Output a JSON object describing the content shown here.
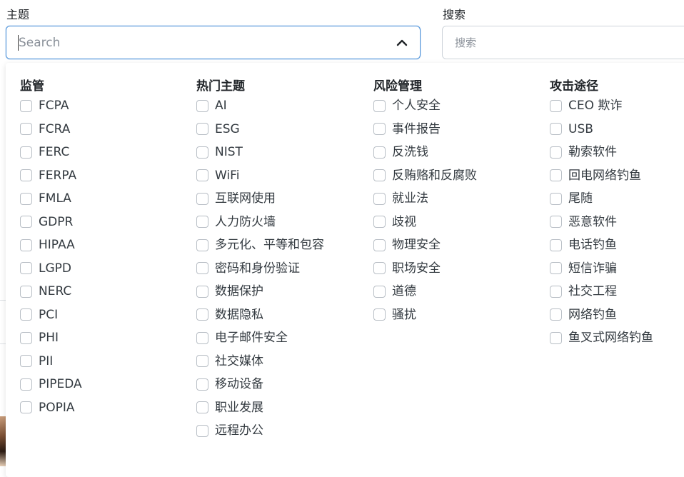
{
  "topic_field": {
    "label": "主题",
    "placeholder": "Search"
  },
  "search_field": {
    "label": "搜索",
    "placeholder": "搜索"
  },
  "accent_color": "#4a90d9",
  "columns": [
    {
      "heading": "监管",
      "options": [
        "FCPA",
        "FCRA",
        "FERC",
        "FERPA",
        "FMLA",
        "GDPR",
        "HIPAA",
        "LGPD",
        "NERC",
        "PCI",
        "PHI",
        "PII",
        "PIPEDA",
        "POPIA"
      ]
    },
    {
      "heading": "热门主题",
      "options": [
        "AI",
        "ESG",
        "NIST",
        "WiFi",
        "互联网使用",
        "人力防火墙",
        "多元化、平等和包容",
        "密码和身份验证",
        "数据保护",
        "数据隐私",
        "电子邮件安全",
        "社交媒体",
        "移动设备",
        "职业发展",
        "远程办公"
      ]
    },
    {
      "heading": "风险管理",
      "options": [
        "个人安全",
        "事件报告",
        "反洗钱",
        "反贿赂和反腐败",
        "就业法",
        "歧视",
        "物理安全",
        "职场安全",
        "道德",
        "骚扰"
      ]
    },
    {
      "heading": "攻击途径",
      "options": [
        "CEO 欺诈",
        "USB",
        "勒索软件",
        "回电网络钓鱼",
        "尾随",
        "恶意软件",
        "电话钓鱼",
        "短信诈骗",
        "社交工程",
        "网络钓鱼",
        "鱼叉式网络钓鱼"
      ]
    }
  ]
}
